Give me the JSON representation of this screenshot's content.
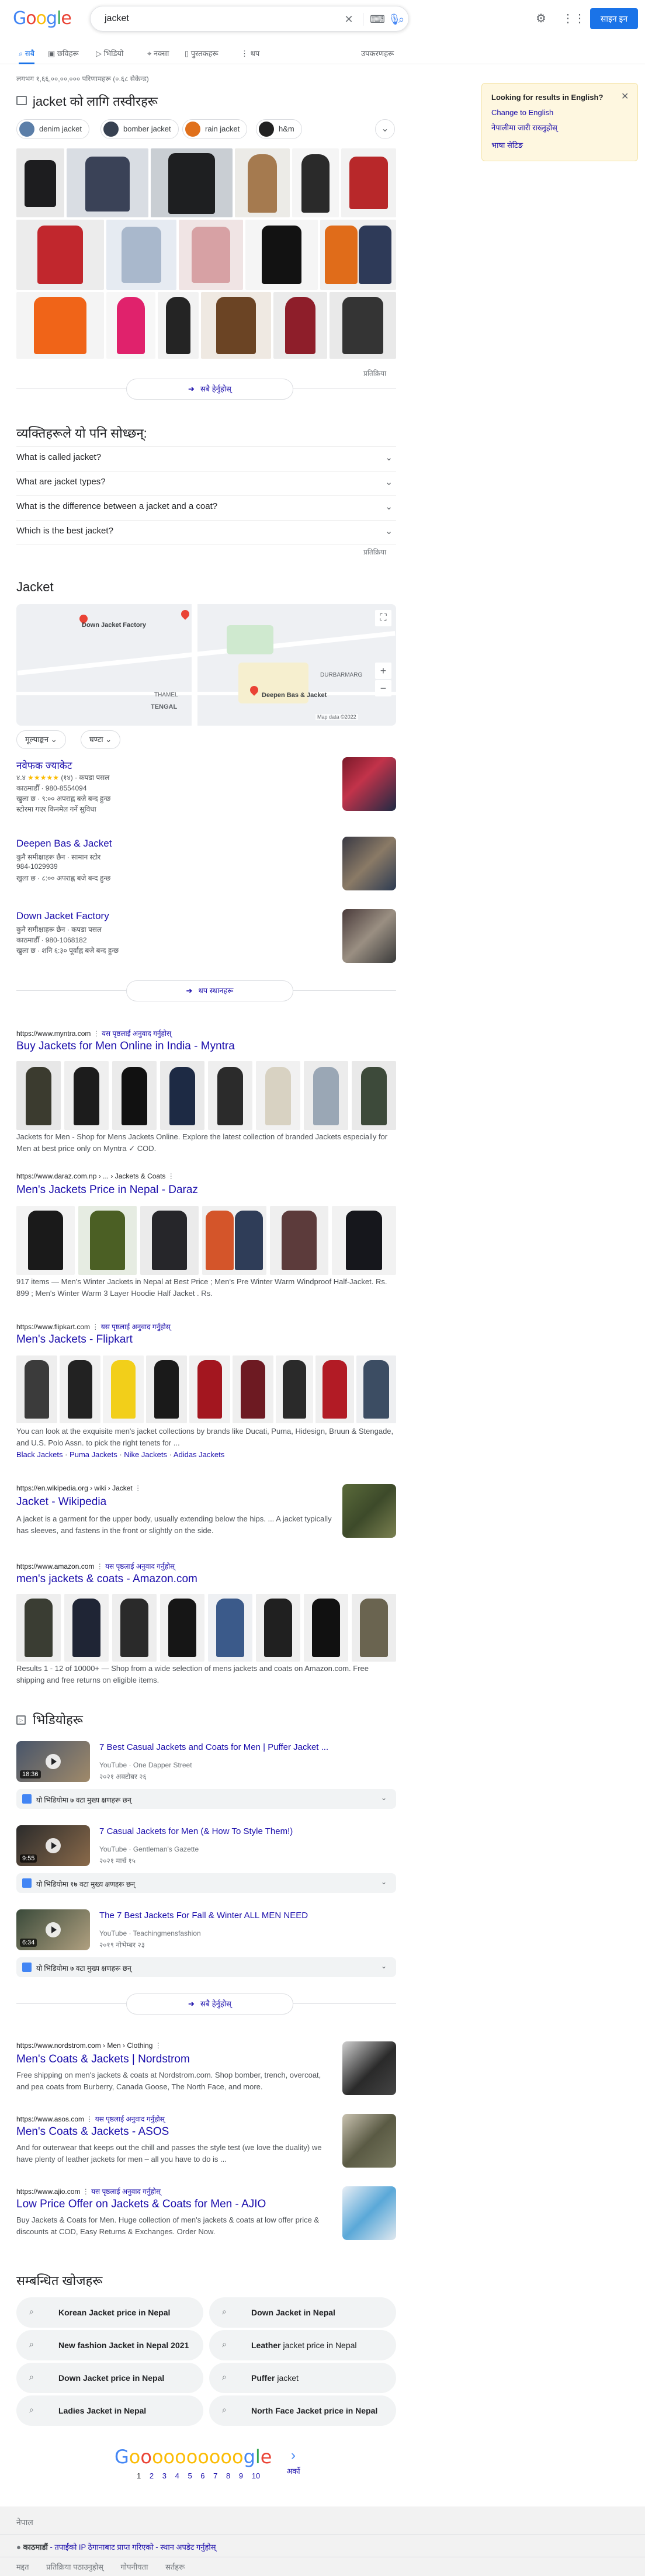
{
  "header": {
    "logo_letters": [
      "G",
      "o",
      "o",
      "g",
      "l",
      "e"
    ],
    "query": "jacket",
    "signin_label": "साइन इन"
  },
  "tabs": {
    "items": [
      {
        "label": "सबै",
        "active": true
      },
      {
        "label": "छविहरू"
      },
      {
        "label": "भिडियो"
      },
      {
        "label": "नक्सा"
      },
      {
        "label": "पुस्तकहरू"
      },
      {
        "label": "थप"
      }
    ],
    "tools_label": "उपकरणहरू"
  },
  "stats": "लगभग १,६६,००,००,००० परिणामहरू (०.६८ सेकेन्ड)",
  "sidebar_box": {
    "title": "Looking for results in English?",
    "change_label": "Change to English",
    "stay_label": "नेपालीमा जारी राख्नुहोस्",
    "lang_settings_label": "भाषा सेटिङ"
  },
  "images_section": {
    "title": "jacket को लागि तस्वीरहरू",
    "chips": [
      {
        "label": "denim jacket",
        "color": "#5b7ea8"
      },
      {
        "label": "bomber jacket",
        "color": "#374151"
      },
      {
        "label": "rain jacket",
        "color": "#e0701b"
      },
      {
        "label": "h&m",
        "color": "#222222"
      }
    ],
    "see_all_label": "सबै हेर्नुहोस्",
    "feedback": "प्रतिक्रिया"
  },
  "paa": {
    "title": "व्यक्तिहरूले यो पनि सोध्छन्:",
    "questions": [
      "What is called jacket?",
      "What are jacket types?",
      "What is the difference between a jacket and a coat?",
      "Which is the best jacket?"
    ],
    "feedback": "प्रतिक्रिया"
  },
  "local": {
    "title": "Jacket",
    "map_labels": {
      "down_jacket_factory": "Down Jacket Factory",
      "deepen": "Deepen Bas & Jacket",
      "durbarmarg": "DURBARMARG",
      "thamel": "THAMEL",
      "tengal": "TENGAL",
      "map_data": "Map data ©2022"
    },
    "filters": [
      "मूल्याङ्कन",
      "घण्टा"
    ],
    "places": [
      {
        "name": "नवेफक ज्याकेट",
        "rating": "४.४",
        "stars": "★★★★★",
        "reviews": "(१४)",
        "type": "कपडा पसल",
        "addr": "काठमाडौँ · 980-8554094",
        "hours": "खुला छ · ९:०० अपराह्न बजे बन्द हुन्छ",
        "extra": "स्टोरमा गएर किनमेल गर्ने सुविधा"
      },
      {
        "name": "Deepen Bas & Jacket",
        "rating": "",
        "stars": "",
        "reviews": "",
        "type": "कुनै समीक्षाहरू छैन · सामान स्टोर",
        "addr": "984-1029939",
        "hours": "खुला छ · ८:०० अपराह्न बजे बन्द हुन्छ",
        "extra": ""
      },
      {
        "name": "Down Jacket Factory",
        "rating": "",
        "stars": "",
        "reviews": "",
        "type": "कुनै समीक्षाहरू छैन · कपडा पसल",
        "addr": "काठमाडौँ · 980-1068182",
        "hours": "खुला छ · शनि ६:३० पूर्वाह्न बजे बन्द हुन्छ",
        "extra": ""
      }
    ],
    "more_label": "थप स्थानहरू"
  },
  "results": [
    {
      "url": "https://www.myntra.com",
      "translate": "यस पृष्ठलाई अनुवाद गर्नुहोस्",
      "title": "Buy Jackets for Men Online in India - Myntra",
      "snippet": "Jackets for Men - Shop for Mens Jackets Online. Explore the latest collection of branded Jackets especially for Men at best price only on Myntra ✓ COD."
    },
    {
      "url": "https://www.daraz.com.np › ... › Jackets & Coats",
      "translate": "",
      "title": "Men's Jackets Price in Nepal - Daraz",
      "snippet": "917 items — Men's Winter Jackets in Nepal at Best Price ; Men's Pre Winter Warm Windproof Half-Jacket. Rs. 899 ; Men's Winter Warm 3 Layer Hoodie Half Jacket . Rs."
    },
    {
      "url": "https://www.flipkart.com",
      "translate": "यस पृष्ठलाई अनुवाद गर्नुहोस्",
      "title": "Men's Jackets - Flipkart",
      "snippet": "You can look at the exquisite men's jacket collections by brands like Ducati, Puma, Hidesign, Bruun & Stengade, and U.S. Polo Assn. to pick the right tenets for ...",
      "links": [
        "Black Jackets",
        "Puma Jackets",
        "Nike Jackets",
        "Adidas Jackets"
      ]
    },
    {
      "url": "https://en.wikipedia.org › wiki › Jacket",
      "translate": "",
      "title": "Jacket - Wikipedia",
      "snippet": "A jacket is a garment for the upper body, usually extending below the hips. ... A jacket typically has sleeves, and fastens in the front or slightly on the side."
    },
    {
      "url": "https://www.amazon.com",
      "translate": "यस पृष्ठलाई अनुवाद गर्नुहोस्",
      "title": "men's jackets & coats - Amazon.com",
      "snippet": "Results 1 - 12 of 10000+ — Shop from a wide selection of mens jackets and coats on Amazon.com. Free shipping and free returns on eligible items."
    }
  ],
  "videos": {
    "title": "भिडियोहरू",
    "items": [
      {
        "title": "7 Best Casual Jackets and Coats for Men | Puffer Jacket ...",
        "source": "YouTube · One Dapper Street",
        "date": "२०२१ अक्टोबर २६",
        "dur": "18:36",
        "key": "यो भिडियोमा ७ वटा मुख्य क्षणहरू छन्"
      },
      {
        "title": "7 Casual Jackets for Men (& How To Style Them!)",
        "source": "YouTube · Gentleman's Gazette",
        "date": "२०२१ मार्च १५",
        "dur": "9:55",
        "key": "यो भिडियोमा १७ वटा मुख्य क्षणहरू छन्"
      },
      {
        "title": "The 7 Best Jackets For Fall & Winter ALL MEN NEED",
        "source": "YouTube · Teachingmensfashion",
        "date": "२०१९ नोभेम्बर २३",
        "dur": "6:34",
        "key": "यो भिडियोमा ७ वटा मुख्य क्षणहरू छन्"
      }
    ],
    "see_all_label": "सबै हेर्नुहोस्"
  },
  "results2": [
    {
      "url": "https://www.nordstrom.com › Men › Clothing",
      "translate": "",
      "title": "Men's Coats & Jackets | Nordstrom",
      "snippet": "Free shipping on men's jackets & coats at Nordstrom.com. Shop bomber, trench, overcoat, and pea coats from Burberry, Canada Goose, The North Face, and more."
    },
    {
      "url": "https://www.asos.com",
      "translate": "यस पृष्ठलाई अनुवाद गर्नुहोस्",
      "title": "Men's Coats & Jackets - ASOS",
      "snippet": "And for outerwear that keeps out the chill and passes the style test (we love the duality) we have plenty of leather jackets for men – all you have to do is ..."
    },
    {
      "url": "https://www.ajio.com",
      "translate": "यस पृष्ठलाई अनुवाद गर्नुहोस्",
      "title": "Low Price Offer on Jackets & Coats for Men - AJIO",
      "snippet": "Buy Jackets & Coats for Men. Huge collection of men's jackets & coats at low offer price & discounts at COD, Easy Returns & Exchanges. Order Now."
    }
  ],
  "related": {
    "title": "सम्बन्धित खोजहरू",
    "items": [
      {
        "bold": "Korean",
        "rest": " Jacket price in Nepal"
      },
      {
        "bold": "",
        "rest": "Down Jacket in Nepal"
      },
      {
        "bold": "New fashion",
        "rest": " Jacket in Nepal 2021"
      },
      {
        "bold": "Leather",
        "rest": " jacket price in Nepal"
      },
      {
        "bold": "",
        "rest": "Down Jacket price in Nepal"
      },
      {
        "bold": "Puffer",
        "rest": " jacket"
      },
      {
        "bold": "Ladies",
        "rest": " Jacket in Nepal"
      },
      {
        "bold": "North Face",
        "rest": " Jacket price in Nepal"
      }
    ]
  },
  "pager": {
    "pages": [
      "1",
      "2",
      "3",
      "4",
      "5",
      "6",
      "7",
      "8",
      "9",
      "10"
    ],
    "next_label": "अर्को"
  },
  "footer": {
    "country": "नेपाल",
    "location": "काठमाडौं",
    "location_detail": "- तपाईंको IP ठेगानाबाट प्राप्त गरिएको - स्थान अपडेट गर्नुहोस्",
    "links": [
      "मद्दत",
      "प्रतिक्रिया पठाउनुहोस्",
      "गोपनीयता",
      "सर्तहरू"
    ]
  },
  "colors": {
    "link": "#1a0dab",
    "accent": "#1a73e8",
    "muted": "#70757a"
  }
}
